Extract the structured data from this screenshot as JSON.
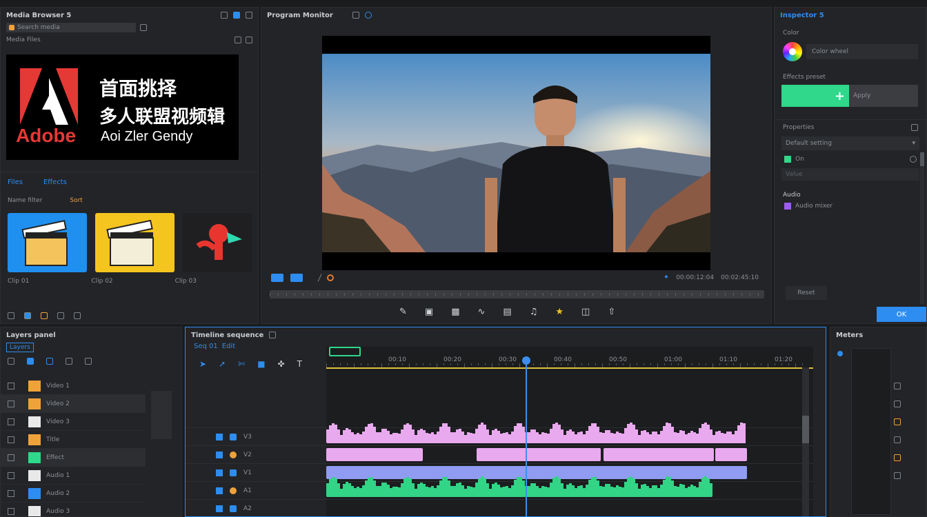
{
  "project": {
    "title": "Media Browser 5",
    "search_value": "Search media",
    "logo_word": "Adobe",
    "banner_line1": "首面挑择",
    "banner_line2": "多人联盟视频辑",
    "banner_line3": "Aoi Zler Gendy",
    "section_label": "Media Files",
    "tabs": [
      "Files",
      "Effects"
    ],
    "filter_labels": [
      "Name filter",
      "Sort"
    ],
    "thumb_captions": [
      "Clip 01",
      "Clip 02",
      "Clip 03"
    ]
  },
  "program": {
    "title": "Program Monitor",
    "timecode_left": "00:00:12:04",
    "timecode_right": "00:02:45:10",
    "tools": [
      "pen-icon",
      "crop-icon",
      "film-icon",
      "wave-icon",
      "camera-icon",
      "audio-icon",
      "highlight-icon",
      "monitor-icon",
      "export-icon"
    ]
  },
  "inspector": {
    "title": "Inspector 5",
    "color_label": "Color wheel",
    "section_effects": "Effects preset",
    "apply_button": "+",
    "apply_label": "Apply",
    "properties_title": "Properties",
    "dropdown_value": "Default setting",
    "toggle_label": "On",
    "input_placeholder": "Value",
    "audio_title": "Audio",
    "audio_item": "Audio mixer",
    "reset_label": "Reset",
    "ok_label": "OK"
  },
  "layers": {
    "title": "Layers panel",
    "tab_label": "Layers",
    "items": [
      "Video 1",
      "Video 2",
      "Video 3",
      "Title",
      "Effect",
      "Audio 1",
      "Audio 2",
      "Audio 3"
    ]
  },
  "timeline": {
    "title": "Timeline sequence",
    "sequence_tabs": [
      "Seq 01",
      "Edit"
    ],
    "ruler_labels": [
      "00:10",
      "00:20",
      "00:30",
      "00:40",
      "00:50",
      "01:00",
      "01:10",
      "01:20"
    ],
    "track_labels": [
      "V3",
      "V2",
      "V1",
      "A1",
      "A2"
    ]
  },
  "meters": {
    "title": "Meters"
  },
  "colors": {
    "accent": "#2e8df0",
    "clip_pink": "#e9a9ee",
    "clip_violet": "#8f9cf2",
    "clip_green": "#32d486",
    "apply_green": "#2fd88a"
  }
}
